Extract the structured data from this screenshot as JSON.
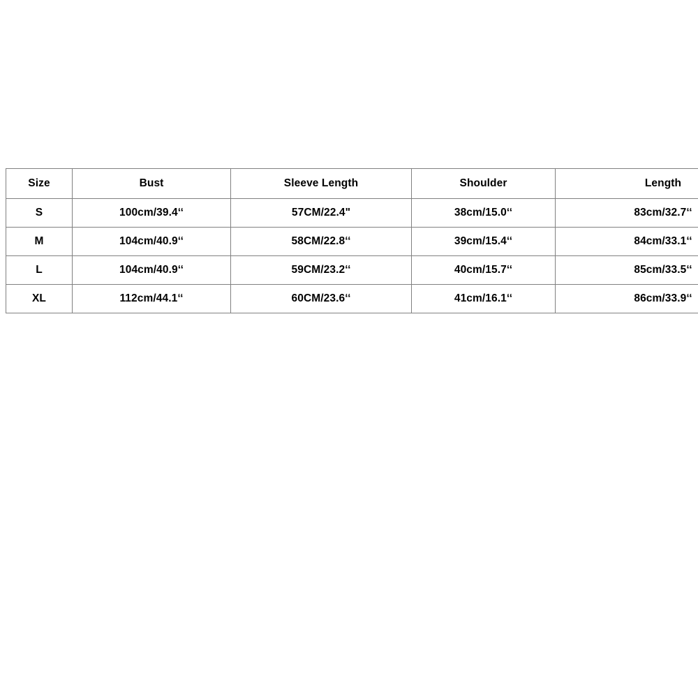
{
  "page": {
    "background_color": "#ffffff",
    "text_color": "#000000",
    "border_color": "#808080"
  },
  "size_chart": {
    "columns": [
      {
        "key": "size",
        "label": "Size"
      },
      {
        "key": "bust",
        "label": "Bust"
      },
      {
        "key": "sleeve",
        "label": "Sleeve Length"
      },
      {
        "key": "shoulder",
        "label": "Shoulder"
      },
      {
        "key": "length",
        "label": "Length"
      }
    ],
    "rows": [
      {
        "size": "S",
        "bust": "100cm/39.4‘‘",
        "sleeve": "57CM/22.4\"",
        "shoulder": "38cm/15.0‘‘",
        "length": "83cm/32.7‘‘"
      },
      {
        "size": "M",
        "bust": "104cm/40.9‘‘",
        "sleeve": "58CM/22.8‘‘",
        "shoulder": "39cm/15.4‘‘",
        "length": "84cm/33.1‘‘"
      },
      {
        "size": "L",
        "bust": "104cm/40.9‘‘",
        "sleeve": "59CM/23.2‘‘",
        "shoulder": "40cm/15.7‘‘",
        "length": "85cm/33.5‘‘"
      },
      {
        "size": "XL",
        "bust": "112cm/44.1‘‘",
        "sleeve": "60CM/23.6‘‘",
        "shoulder": "41cm/16.1‘‘",
        "length": "86cm/33.9‘‘"
      }
    ]
  }
}
